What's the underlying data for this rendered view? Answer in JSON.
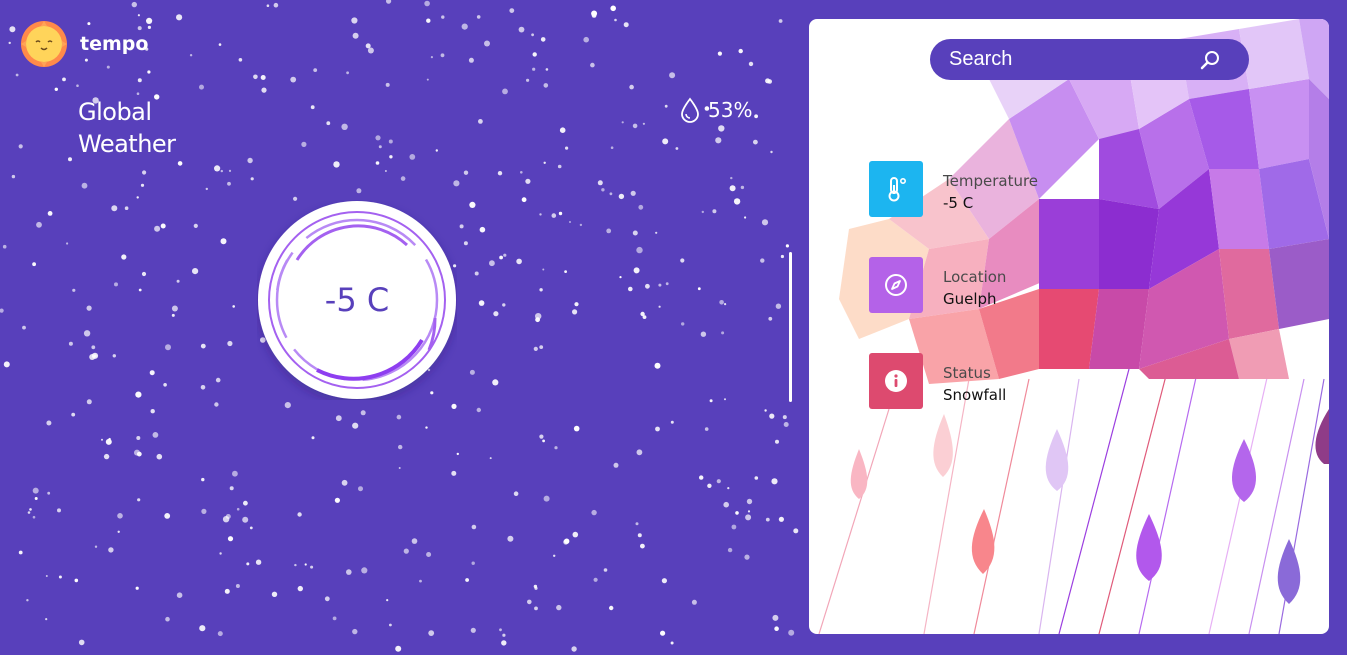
{
  "app": {
    "name": "tempo",
    "title_line1": "Global",
    "title_line2": "Weather"
  },
  "humidity": {
    "value": "53%",
    "icon": "droplet-icon"
  },
  "dial": {
    "temperature": "-5 C"
  },
  "search": {
    "placeholder": "Search",
    "icon": "search-icon"
  },
  "info": [
    {
      "label": "Temperature",
      "value": "-5 C",
      "icon": "thermometer-icon",
      "color": "#1cb5f0"
    },
    {
      "label": "Location",
      "value": "Guelph",
      "icon": "compass-icon",
      "color": "#b462e8"
    },
    {
      "label": "Status",
      "value": "Snowfall",
      "icon": "info-icon",
      "color": "#dd4a6f"
    }
  ],
  "colors": {
    "background": "#5840bb",
    "panel": "#ffffff",
    "sun": "#ffd45a",
    "sun_rays": "#ff8a4a"
  }
}
